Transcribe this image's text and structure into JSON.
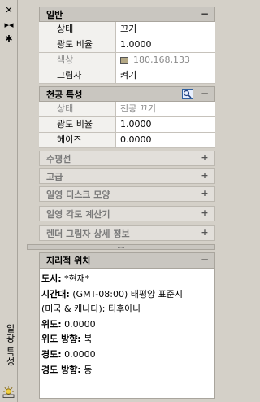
{
  "palette_title": "일광 특성",
  "sections": {
    "general": {
      "title": "일반",
      "collapse_label": "−",
      "rows": [
        {
          "key": "상태",
          "value": "끄기"
        },
        {
          "key": "광도 비율",
          "value": "1.0000"
        },
        {
          "key": "색상",
          "value": "180,168,133"
        },
        {
          "key": "그림자",
          "value": "켜기"
        }
      ]
    },
    "sky": {
      "title": "천공 특성",
      "collapse_label": "−",
      "rows": [
        {
          "key": "상태",
          "value": "천공 끄기"
        },
        {
          "key": "광도 비율",
          "value": "1.0000"
        },
        {
          "key": "헤이즈",
          "value": "0.0000"
        }
      ]
    },
    "collapsed": [
      {
        "title": "수평선",
        "expand_label": "+"
      },
      {
        "title": "고급",
        "expand_label": "+"
      },
      {
        "title": "일영 디스크 모양",
        "expand_label": "+"
      },
      {
        "title": "일영 각도 계산기",
        "expand_label": "+"
      },
      {
        "title": "렌더 그림자 상세 정보",
        "expand_label": "+"
      }
    ],
    "geo": {
      "title": "지리적 위치",
      "collapse_label": "−",
      "city_label": "도시:",
      "city_value": "*현재*",
      "tz_label": "시간대:",
      "tz_value": "(GMT-08:00) 태평양 표준시",
      "tz_value2": "(미국 & 캐나다); 티후아나",
      "lat_label": "위도:",
      "lat_value": "0.0000",
      "latdir_label": "위도 방향:",
      "latdir_value": "북",
      "lon_label": "경도:",
      "lon_value": "0.0000",
      "londir_label": "경도 방향:",
      "londir_value": "동"
    }
  },
  "divider_grip": "....",
  "colors": {
    "swatch": "#b4a885"
  }
}
